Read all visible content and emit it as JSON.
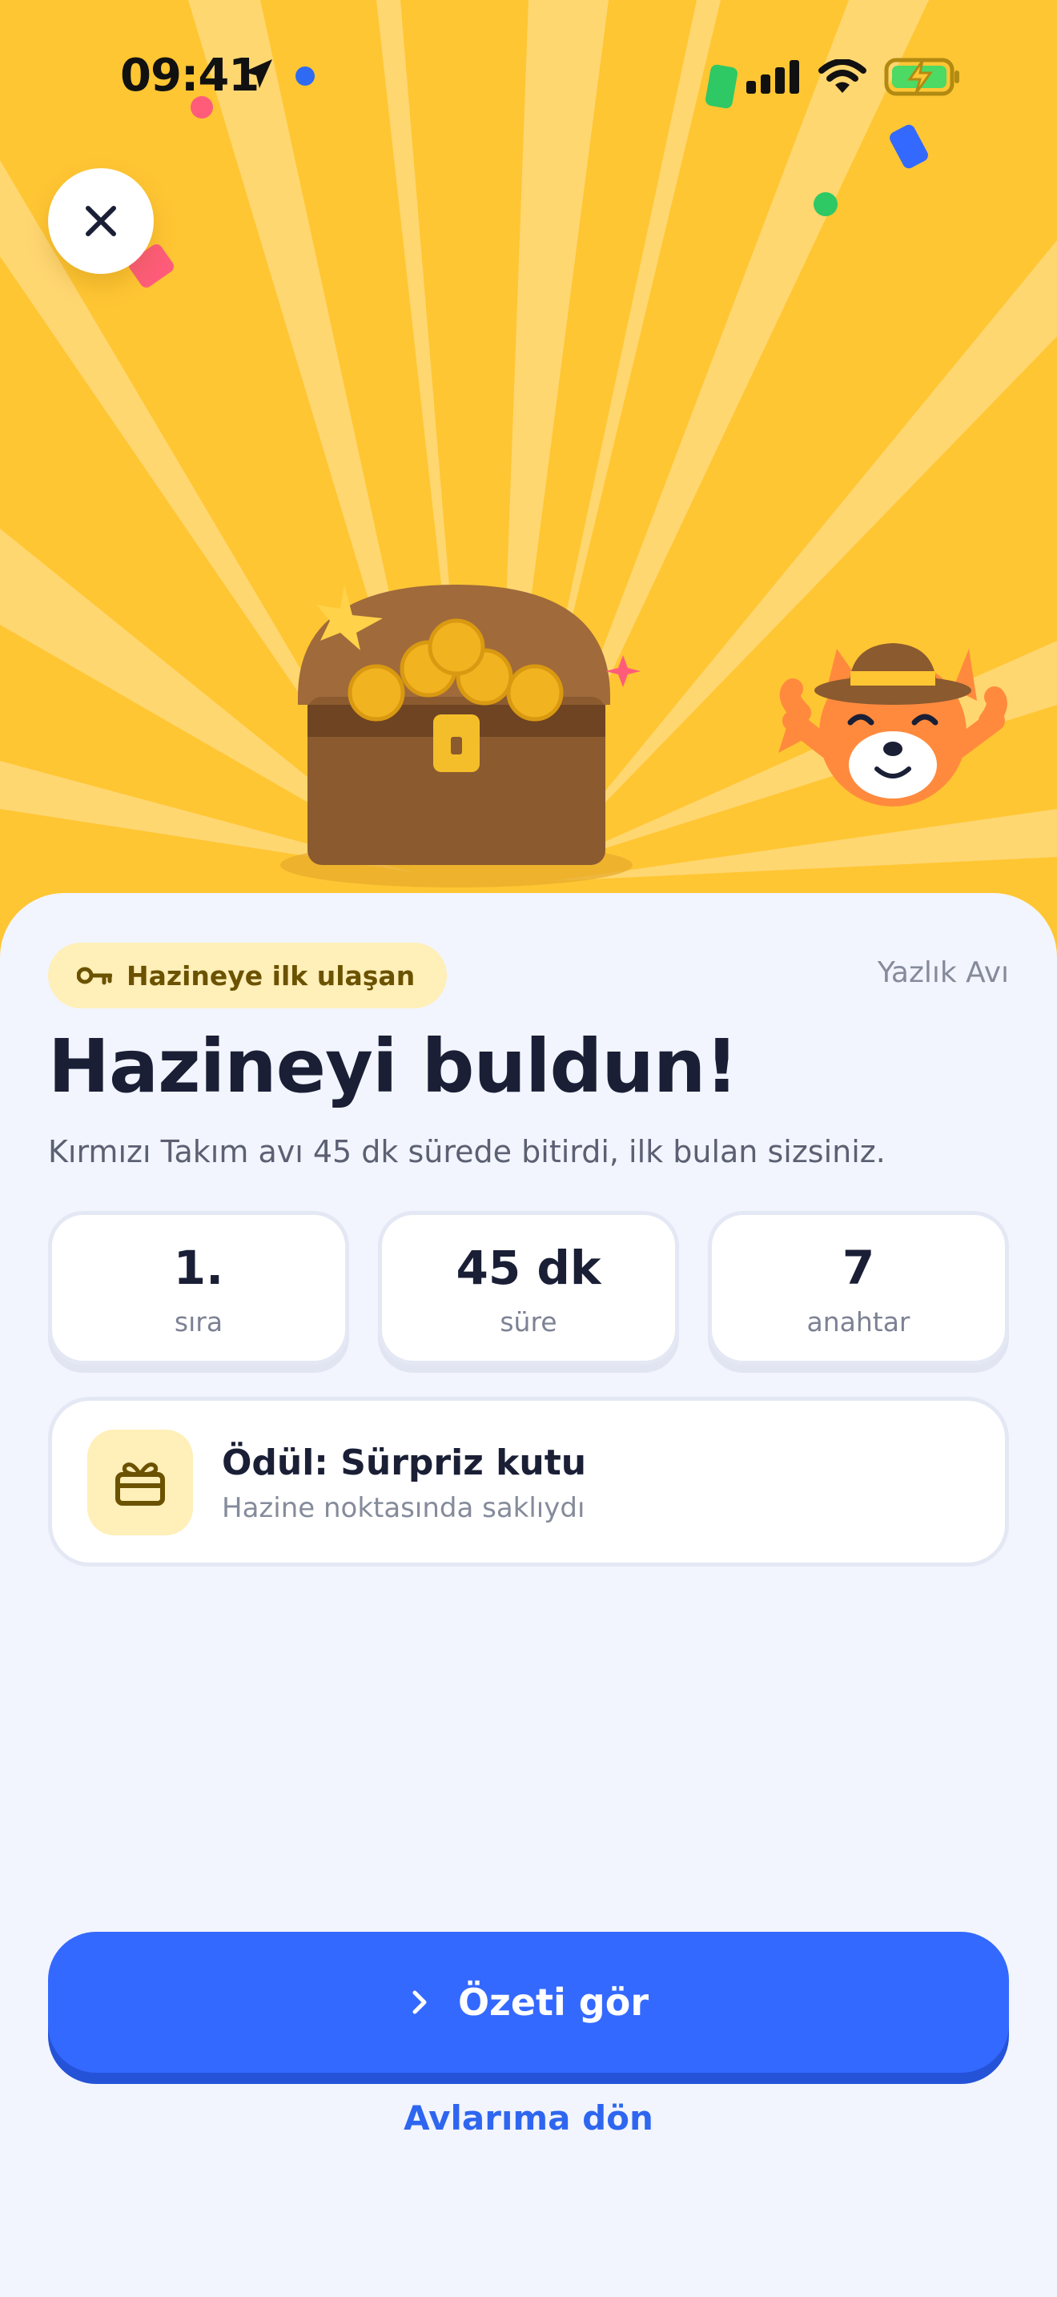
{
  "status_bar": {
    "time": "09:41"
  },
  "hero": {
    "close_icon": "close-icon"
  },
  "card": {
    "badge_label": "Hazineye ilk ulaşan",
    "badge_icon": "key-icon",
    "hunt_name": "Yazlık Avı",
    "title": "Hazineyi buldun!",
    "subtitle": "Kırmızı Takım avı 45 dk sürede bitirdi, ilk bulan sizsiniz.",
    "stats": [
      {
        "value": "1.",
        "label": "sıra"
      },
      {
        "value": "45 dk",
        "label": "süre"
      },
      {
        "value": "7",
        "label": "anahtar"
      }
    ],
    "reward": {
      "icon": "gift-icon",
      "title": "Ödül: Sürpriz kutu",
      "description": "Hazine noktasında saklıydı"
    }
  },
  "actions": {
    "primary_label": "Özeti gör",
    "secondary_label": "Avlarıma dön"
  },
  "colors": {
    "hero_background": "#FFC633",
    "primary": "#3469FF",
    "badge_background": "#FFEFB8"
  }
}
